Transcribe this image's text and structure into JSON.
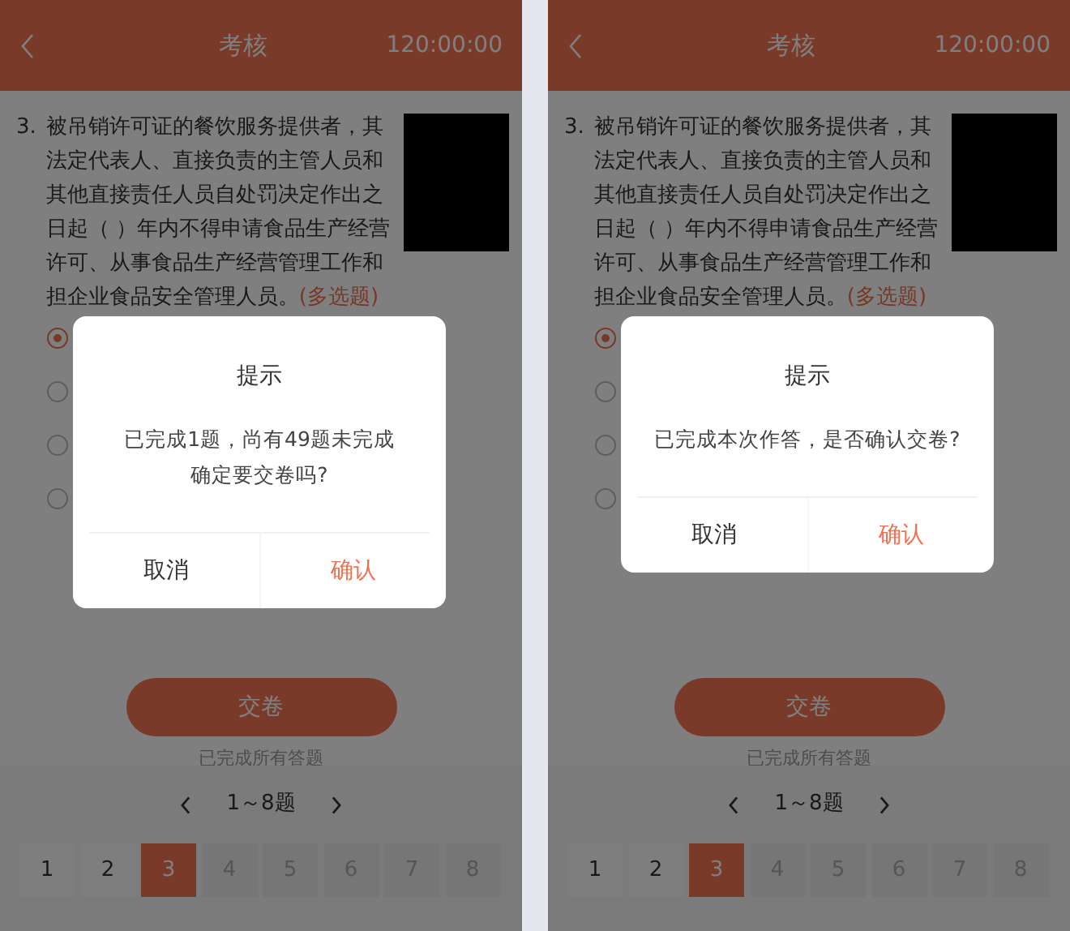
{
  "screens": [
    {
      "header": {
        "title": "考核",
        "timer": "120:00:00"
      },
      "question": {
        "number": "3.",
        "text": "被吊销许可证的餐饮服务提供者，其法定代表人、直接负责的主管人员和其他直接责任人员自处罚决定作出之日起（ ）年内不得申请食品生产经营许可、从事食品生产经营管理工作和担企业食品安全管理人员。",
        "tag": "(多选题)"
      },
      "options": [
        {
          "selected": true
        },
        {
          "selected": false
        },
        {
          "selected": false
        },
        {
          "selected": false
        }
      ],
      "submit_button": "交卷",
      "submit_hint": "已完成所有答题",
      "pager_range": "1～8题",
      "question_numbers": [
        {
          "label": "1",
          "selected": false,
          "answered": true
        },
        {
          "label": "2",
          "selected": false,
          "answered": true
        },
        {
          "label": "3",
          "selected": true,
          "answered": true
        },
        {
          "label": "4",
          "selected": false,
          "answered": false
        },
        {
          "label": "5",
          "selected": false,
          "answered": false
        },
        {
          "label": "6",
          "selected": false,
          "answered": false
        },
        {
          "label": "7",
          "selected": false,
          "answered": false
        },
        {
          "label": "8",
          "selected": false,
          "answered": false
        }
      ],
      "dialog": {
        "title": "提示",
        "message_lines": [
          "已完成1题，尚有49题未完成",
          "确定要交卷吗?"
        ],
        "buttons": [
          {
            "label": "取消",
            "kind": "cancel"
          },
          {
            "label": "确认",
            "kind": "confirm"
          }
        ]
      }
    },
    {
      "header": {
        "title": "考核",
        "timer": "120:00:00"
      },
      "question": {
        "number": "3.",
        "text": "被吊销许可证的餐饮服务提供者，其法定代表人、直接负责的主管人员和其他直接责任人员自处罚决定作出之日起（ ）年内不得申请食品生产经营许可、从事食品生产经营管理工作和担企业食品安全管理人员。",
        "tag": "(多选题)"
      },
      "options": [
        {
          "selected": true
        },
        {
          "selected": false
        },
        {
          "selected": false
        },
        {
          "selected": false
        }
      ],
      "submit_button": "交卷",
      "submit_hint": "已完成所有答题",
      "pager_range": "1～8题",
      "question_numbers": [
        {
          "label": "1",
          "selected": false,
          "answered": true
        },
        {
          "label": "2",
          "selected": false,
          "answered": true
        },
        {
          "label": "3",
          "selected": true,
          "answered": true
        },
        {
          "label": "4",
          "selected": false,
          "answered": false
        },
        {
          "label": "5",
          "selected": false,
          "answered": false
        },
        {
          "label": "6",
          "selected": false,
          "answered": false
        },
        {
          "label": "7",
          "selected": false,
          "answered": false
        },
        {
          "label": "8",
          "selected": false,
          "answered": false
        }
      ],
      "dialog": {
        "title": "提示",
        "message_lines": [
          "已完成本次作答，是否确认交卷?"
        ],
        "buttons": [
          {
            "label": "取消",
            "kind": "cancel"
          },
          {
            "label": "确认",
            "kind": "confirm"
          }
        ]
      }
    }
  ]
}
